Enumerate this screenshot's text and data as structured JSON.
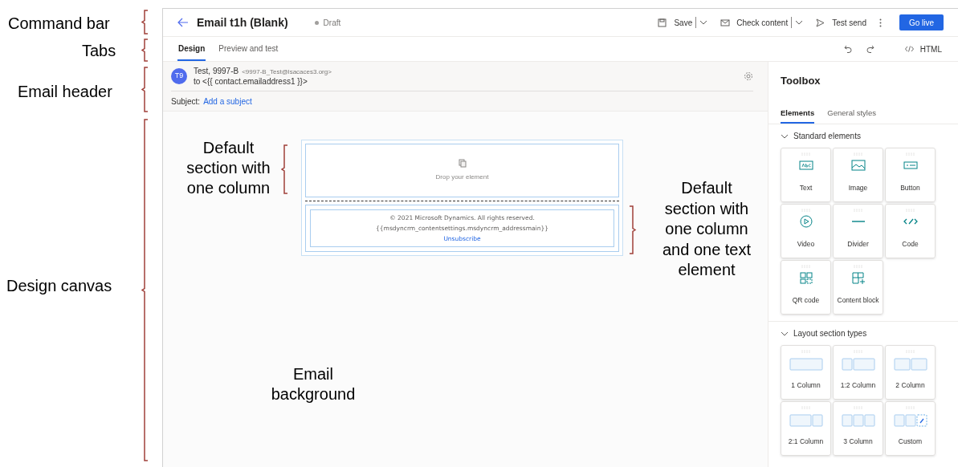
{
  "annotations": [
    {
      "text": "Command bar"
    },
    {
      "text": "Tabs"
    },
    {
      "text": "Email header"
    },
    {
      "text": "Design canvas"
    },
    {
      "text": "Default section with one column"
    },
    {
      "text": "Default section with one column and one text element"
    },
    {
      "text": "Email background"
    }
  ],
  "command_bar": {
    "title": "Email t1h (Blank)",
    "status": "Draft",
    "actions": [
      {
        "label": "Save",
        "split": true
      },
      {
        "label": "Check content",
        "split": true
      },
      {
        "label": "Test send",
        "split": false
      }
    ],
    "primary": "Go live"
  },
  "tabs": [
    {
      "label": "Design",
      "selected": true
    },
    {
      "label": "Preview and test",
      "selected": false
    }
  ],
  "html_button": "HTML",
  "email_header": {
    "avatar": "T9",
    "sender": "Test, 9997-B",
    "sender_address": "<9997-B_Test@lsacaces3.org>",
    "to": "to <{{ contact.emailaddress1 }}>",
    "subject_label": "Subject:",
    "subject_placeholder": "Add a subject"
  },
  "canvas": {
    "drop_text": "Drop your element",
    "footer_lines": [
      "© 2021 Microsoft Dynamics. All rights reserved.",
      "{{msdyncrm_contentsettings.msdyncrm_addressmain}}"
    ],
    "footer_link": "Unsubscribe"
  },
  "toolbox": {
    "title": "Toolbox",
    "tabs": [
      {
        "label": "Elements",
        "selected": true
      },
      {
        "label": "General styles",
        "selected": false
      }
    ],
    "sections": [
      {
        "title": "Standard elements",
        "expanded": true,
        "kind": "element",
        "items": [
          "Text",
          "Image",
          "Button",
          "Video",
          "Divider",
          "Code",
          "QR code",
          "Content block"
        ]
      },
      {
        "title": "Layout section types",
        "expanded": true,
        "kind": "layout",
        "items": [
          "1 Column",
          "1:2 Column",
          "2 Column",
          "2:1 Column",
          "3 Column",
          "Custom"
        ]
      }
    ]
  }
}
